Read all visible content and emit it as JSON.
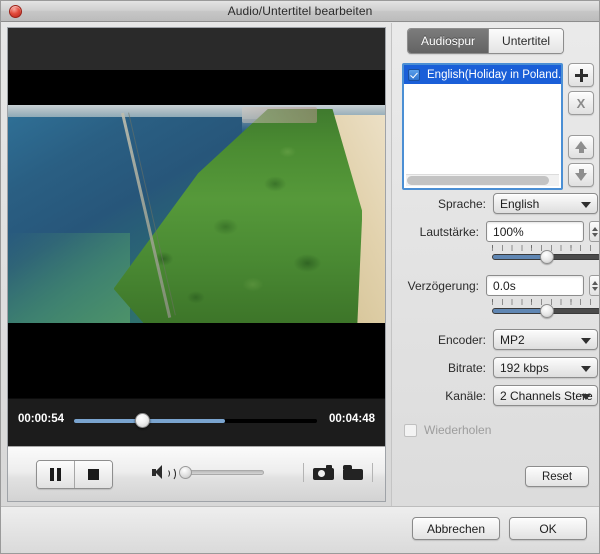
{
  "window": {
    "title": "Audio/Untertitel bearbeiten",
    "close_icon": "close-icon"
  },
  "player": {
    "current_time": "00:00:54",
    "total_time": "00:04:48",
    "progress_percent": 28,
    "buffer_percent": 62,
    "volume_percent": 2,
    "pause_icon": "pause-icon",
    "stop_icon": "stop-icon",
    "speaker_icon": "speaker-icon",
    "snapshot_icon": "camera-icon",
    "folder_icon": "folder-icon"
  },
  "tabs": [
    {
      "label": "Audiospur",
      "active": true
    },
    {
      "label": "Untertitel",
      "active": false
    }
  ],
  "track_list": {
    "items": [
      {
        "label": "English(Holiday in Poland.flv)",
        "checked": true,
        "selected": true
      }
    ],
    "buttons": [
      {
        "name": "add-track-button",
        "icon": "plus-icon"
      },
      {
        "name": "remove-track-button",
        "icon": "x-icon"
      },
      {
        "name": "move-up-button",
        "icon": "arrow-up-icon"
      },
      {
        "name": "move-down-button",
        "icon": "arrow-down-icon"
      }
    ]
  },
  "form": {
    "sprache": {
      "label": "Sprache:",
      "value": "English"
    },
    "lautstaerke": {
      "label": "Lautstärke:",
      "value": "100%",
      "slider_percent": 50
    },
    "verzoegerung": {
      "label": "Verzögerung:",
      "value": "0.0s",
      "slider_percent": 50
    },
    "encoder": {
      "label": "Encoder:",
      "value": "MP2"
    },
    "bitrate": {
      "label": "Bitrate:",
      "value": "192 kbps"
    },
    "kanaele": {
      "label": "Kanäle:",
      "value": "2 Channels Stere"
    },
    "wiederholen": {
      "label": "Wiederholen",
      "checked": false,
      "enabled": false
    },
    "reset_label": "Reset"
  },
  "footer": {
    "cancel_label": "Abbrechen",
    "ok_label": "OK"
  },
  "colors": {
    "accent_blue": "#1a5fd8",
    "list_border": "#4b8fd4",
    "progress_fill": "#7aa4cf",
    "slider_fill": "#5f86b3",
    "tab_active_bg": "#6f6f6f"
  }
}
